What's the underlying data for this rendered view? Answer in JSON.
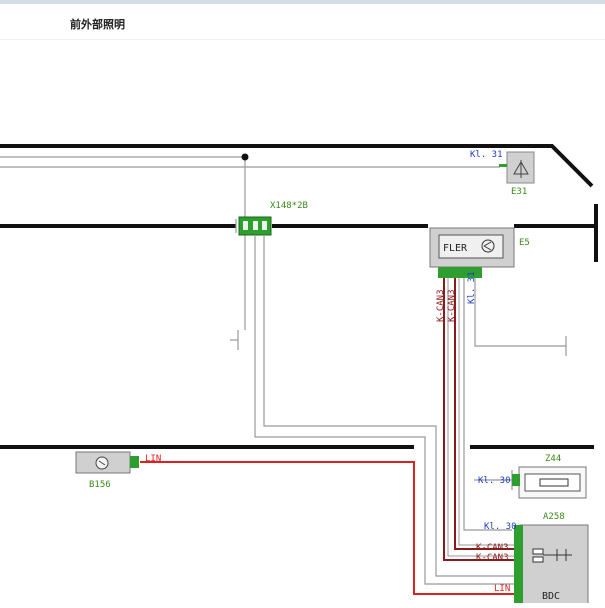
{
  "header": {
    "title": "前外部照明"
  },
  "components": {
    "e31": {
      "label": "E31",
      "pin_label": "Kl. 31"
    },
    "x148": {
      "label": "X148*2B"
    },
    "e5": {
      "label": "E5",
      "box_text": "FLER"
    },
    "e5_wires": [
      "K-CAN3",
      "K-CAN3",
      "Kl. 31"
    ],
    "b156": {
      "label": "B156",
      "wire_label": "LIN"
    },
    "z44": {
      "label": "Z44",
      "pin_label": "Kl. 30"
    },
    "a258": {
      "label": "A258",
      "box_text": "BDC",
      "pins": [
        "Kl. 30",
        "K-CAN3",
        "K-CAN3",
        "LIN"
      ]
    }
  },
  "colors": {
    "can_wire": "#8b1a1a",
    "lin_wire": "#e02020",
    "connector": "#2e9e2e",
    "label_green": "#3a8a1a",
    "label_blue": "#1a3ad0",
    "grey_wire": "#999999",
    "bus_line": "#111111",
    "component_fill": "#d0d0d0"
  }
}
